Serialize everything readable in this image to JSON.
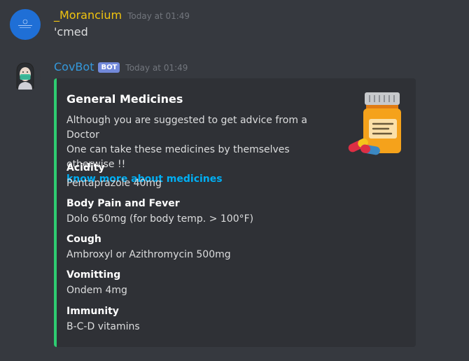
{
  "messages": [
    {
      "username": "_Morancium",
      "timestamp": "Today at 01:49",
      "content": "'cmed",
      "avatar_icon": "user-avatar-icon"
    },
    {
      "username": "CovBot",
      "bot_tag": "BOT",
      "timestamp": "Today at 01:49",
      "avatar_icon": "masked-person-icon"
    }
  ],
  "embed": {
    "accent_color": "#2ecc71",
    "title": "General Medicines",
    "description_line1": "Although you are suggested to get advice from a Doctor",
    "description_line2": "One can take these medicines by themselves otherwise !!",
    "link_text": "know more about medicines",
    "thumbnail_icon": "pill-bottle-icon",
    "fields": [
      {
        "name": "Acidity",
        "value": "Pentaprazole 40mg"
      },
      {
        "name": "Body Pain and Fever",
        "value": "Dolo 650mg (for body temp. > 100°F)"
      },
      {
        "name": "Cough",
        "value": "Ambroxyl or Azithromycin 500mg"
      },
      {
        "name": "Vomitting",
        "value": "Ondem 4mg"
      },
      {
        "name": "Immunity",
        "value": "B-C-D vitamins"
      }
    ]
  },
  "colors": {
    "background": "#36393f",
    "embed_background": "#2f3136",
    "user_name": "#f1c40f",
    "bot_name": "#3498db",
    "link": "#00aff4",
    "bot_tag": "#7289da"
  }
}
